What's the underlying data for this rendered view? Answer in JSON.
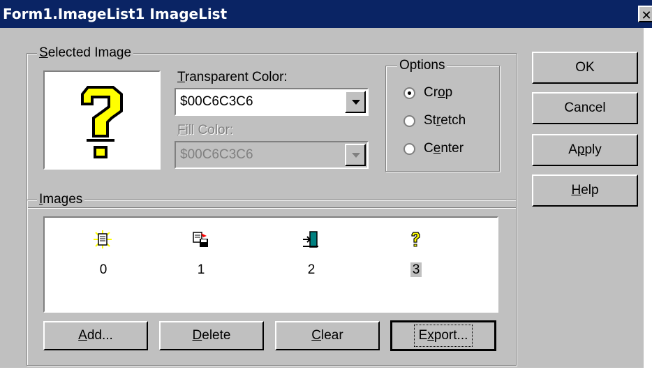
{
  "window": {
    "title": "Form1.ImageList1 ImageList",
    "close_symbol": "✕"
  },
  "selected_image": {
    "group_label_prefix": "",
    "group_label_accel": "S",
    "group_label_rest": "elected Image",
    "preview_icon": "question-mark-icon"
  },
  "transparent_color": {
    "label_accel": "T",
    "label_rest": "ransparent Color:",
    "value": "$00C6C3C6"
  },
  "fill_color": {
    "label_accel": "F",
    "label_rest": "ill Color:",
    "value": "$00C6C3C6"
  },
  "options": {
    "label": "Options",
    "items": [
      {
        "pre": "Cr",
        "accel": "o",
        "post": "p",
        "checked": true
      },
      {
        "pre": "St",
        "accel": "r",
        "post": "etch",
        "checked": false
      },
      {
        "pre": "C",
        "accel": "e",
        "post": "nter",
        "checked": false
      }
    ]
  },
  "images": {
    "group_label_accel": "I",
    "group_label_rest": "mages",
    "items": [
      {
        "caption": "0",
        "icon": "new-document-icon",
        "selected": false
      },
      {
        "caption": "1",
        "icon": "save-document-icon",
        "selected": false
      },
      {
        "caption": "2",
        "icon": "exit-door-icon",
        "selected": false
      },
      {
        "caption": "3",
        "icon": "question-mark-icon",
        "selected": true
      }
    ]
  },
  "list_buttons": {
    "add": {
      "accel": "A",
      "rest": "dd..."
    },
    "delete": {
      "accel": "D",
      "rest": "elete"
    },
    "clear": {
      "accel": "C",
      "rest": "lear"
    },
    "export": {
      "pre": "E",
      "accel": "x",
      "rest": "port..."
    }
  },
  "dialog_buttons": {
    "ok": "OK",
    "cancel": "Cancel",
    "apply": {
      "pre": "A",
      "accel": "p",
      "rest": "ply"
    },
    "help": {
      "accel": "H",
      "rest": "elp"
    }
  },
  "colors": {
    "title_bar": "#0a2464",
    "face": "#c0c0c0",
    "icon_yellow": "#ffff00"
  }
}
